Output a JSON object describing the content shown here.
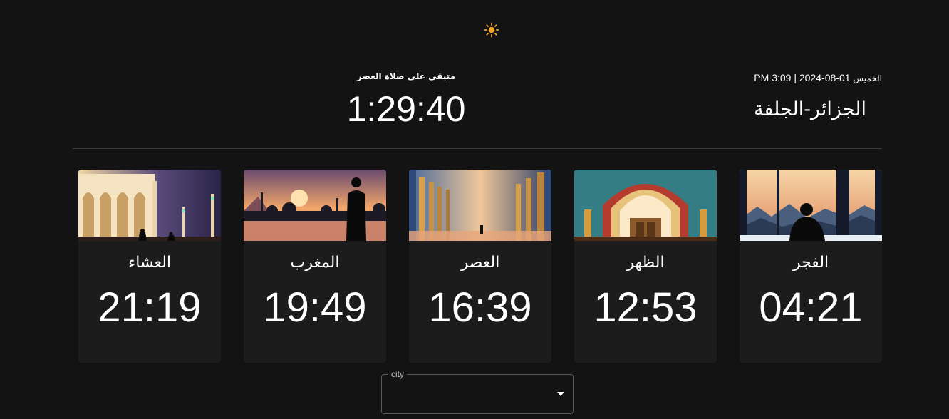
{
  "header": {
    "theme_toggle_icon": "sun-icon",
    "accent_color": "#f5a623"
  },
  "countdown": {
    "label": "متبقي على صلاة العصر",
    "value": "1:29:40"
  },
  "current": {
    "weekday": "الخميس",
    "datetime": "01-08-2024 | 3:09 PM",
    "location": "الجزائر-الجلفة"
  },
  "prayers": [
    {
      "name": "الفجر",
      "time": "04:21",
      "image": "mountains-window-silhouette"
    },
    {
      "name": "الظهر",
      "time": "12:53",
      "image": "mosque-arch"
    },
    {
      "name": "العصر",
      "time": "16:39",
      "image": "columns-hall"
    },
    {
      "name": "المغرب",
      "time": "19:49",
      "image": "sunset-mosque-silhouette"
    },
    {
      "name": "العشاء",
      "time": "21:19",
      "image": "night-mosque-minarets"
    }
  ],
  "city_select": {
    "label": "city",
    "value": "",
    "arrow_icon": "caret-down-icon"
  }
}
